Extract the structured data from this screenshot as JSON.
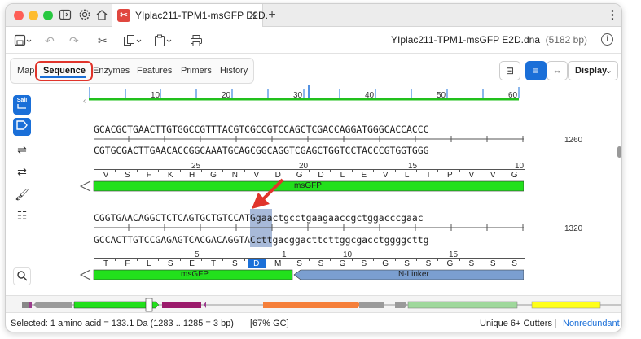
{
  "titlebar": {
    "doc_tab_title": "YIplac211-TPM1-msGFP E2D.",
    "new_tab_label": "+",
    "menu_label": "⋮"
  },
  "toolbar": {
    "filename": "YIplac211-TPM1-msGFP E2D.dna",
    "bp_count": "(5182 bp)"
  },
  "view_tabs": [
    {
      "label": "Map",
      "active": false
    },
    {
      "label": "Sequence",
      "active": true
    },
    {
      "label": "Enzymes",
      "active": false
    },
    {
      "label": "Features",
      "active": false
    },
    {
      "label": "Primers",
      "active": false
    },
    {
      "label": "History",
      "active": false
    }
  ],
  "display_button": "Display",
  "enzyme_tool_label": "SalI",
  "ruler_labels": [
    "10",
    "20",
    "30",
    "40",
    "50",
    "60"
  ],
  "block1": {
    "top_strand": "GCACGCTGAACTTGTGGCCGTTTACGTCGCCGTCCAGCTCGACCAGGATGGGCACCACCC",
    "bottom_strand": "CGTGCGACTTGAACACCGGCAAATGCAGCGGCAGGTCGAGCTGGTCCTACCCGTGGTGGG",
    "coord": "1260",
    "aa_numbers": [
      "25",
      "20",
      "15",
      "10"
    ],
    "aa_letters": [
      "V",
      "S",
      "F",
      "K",
      "H",
      "G",
      "N",
      "V",
      "D",
      "G",
      "D",
      "L",
      "E",
      "V",
      "L",
      "I",
      "P",
      "V",
      "V",
      "G"
    ],
    "feature_label": "msGFP"
  },
  "block2": {
    "top_strand": "CGGTGAACAGGCTCTCAGTGCTGTCCATGgaactgcctgaagaaccgctggacccgaac",
    "bottom_strand": "GCCACTTGTCCGAGAGTCACGACAGGTACcttgacggacttcttggcgacctggggcttg",
    "coord": "1320",
    "aa_numbers": [
      "5",
      "1",
      "10",
      "15"
    ],
    "aa_letters": [
      "T",
      "F",
      "L",
      "S",
      "E",
      "T",
      "S",
      "D",
      "M",
      "S",
      "S",
      "G",
      "S",
      "G",
      "S",
      "S",
      "G",
      "S",
      "S",
      "S"
    ],
    "feature_msgfp": "msGFP",
    "feature_linker": "N-Linker"
  },
  "status": {
    "selected": "Selected:  1 amino acid  =  133.1 Da   (1283 .. 1285  =  3 bp)",
    "gc": "[67% GC]",
    "cutters": "Unique 6+ Cutters",
    "nonredundant": "Nonredundant"
  },
  "colors": {
    "feature_green": "#22e01c",
    "linker_blue": "#7b9fd0",
    "selection_blue": "#8ba3cc",
    "accent": "#1a6fd8",
    "annotation_red": "#e0342b"
  }
}
